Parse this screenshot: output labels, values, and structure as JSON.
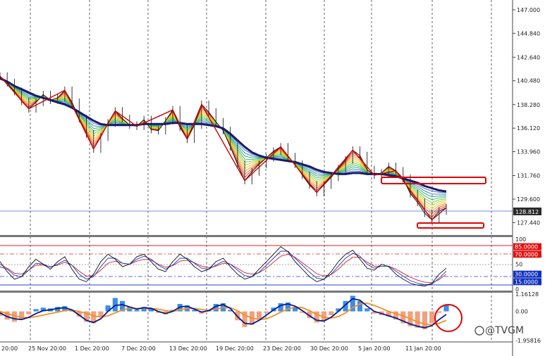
{
  "chart_data": {
    "type": "line",
    "instrument_panel": {
      "price_label": "128.812",
      "y_ticks": [
        "147.000",
        "144.840",
        "142.640",
        "140.480",
        "138.280",
        "136.120",
        "133.960",
        "131.760",
        "129.600",
        "127.440"
      ],
      "y_tick_values": [
        147.0,
        144.84,
        142.64,
        140.48,
        138.28,
        136.12,
        133.96,
        131.76,
        129.6,
        127.44
      ],
      "ylim": [
        126.3,
        147.9
      ],
      "current_price": 128.812
    },
    "x_tick_labels": [
      "20:00",
      "25 Nov 20:00",
      "1 Dec 20:00",
      "7 Dec 20:00",
      "13 Dec 20:00",
      "19 Dec 20:00",
      "23 Dec 20:00",
      "30 Dec 20:00",
      "5 Jan 20:00",
      "11 Jan 20:00"
    ],
    "price_series": [
      140.9,
      140.3,
      139.5,
      138.6,
      137.9,
      138.5,
      139.2,
      138.7,
      138.9,
      139.6,
      138.5,
      137.0,
      135.6,
      134.2,
      135.3,
      136.6,
      137.7,
      137.0,
      136.4,
      136.3,
      136.9,
      136.0,
      135.9,
      136.8,
      137.8,
      136.2,
      135.1,
      136.4,
      138.3,
      137.6,
      136.7,
      135.9,
      134.4,
      132.8,
      131.3,
      132.1,
      132.8,
      133.4,
      134.0,
      134.4,
      133.5,
      132.8,
      131.8,
      130.9,
      130.2,
      130.9,
      131.6,
      132.4,
      133.2,
      134.1,
      133.6,
      132.3,
      131.8,
      132.0,
      132.6,
      132.2,
      131.5,
      130.1,
      129.3,
      128.3,
      127.7,
      128.5,
      128.8
    ],
    "ma_series": [
      140.7,
      140.4,
      140.0,
      139.7,
      139.4,
      139.1,
      138.9,
      138.7,
      138.5,
      138.3,
      138.0,
      137.6,
      137.2,
      136.8,
      136.5,
      136.4,
      136.4,
      136.4,
      136.4,
      136.4,
      136.5,
      136.5,
      136.5,
      136.5,
      136.6,
      136.6,
      136.5,
      136.5,
      136.5,
      136.4,
      136.3,
      136.1,
      135.6,
      135.0,
      134.4,
      133.9,
      133.6,
      133.4,
      133.3,
      133.2,
      133.1,
      133.0,
      132.8,
      132.6,
      132.3,
      132.1,
      132.0,
      131.9,
      131.9,
      132.0,
      132.0,
      131.9,
      131.9,
      131.9,
      131.8,
      131.7,
      131.5,
      131.3,
      131.1,
      130.8,
      130.6,
      130.4,
      130.3
    ],
    "stoch_panel": {
      "y_ticks": [
        "100",
        "85.0000",
        "70.0000",
        "50",
        "30.0000",
        "15.0000",
        "0"
      ],
      "levels": [
        85,
        70,
        50,
        30,
        15
      ],
      "ylim": [
        0,
        100
      ],
      "series_a": [
        55,
        35,
        20,
        25,
        45,
        60,
        50,
        40,
        55,
        65,
        40,
        20,
        15,
        30,
        55,
        70,
        60,
        45,
        50,
        65,
        70,
        55,
        40,
        35,
        55,
        70,
        60,
        45,
        35,
        40,
        55,
        62,
        45,
        30,
        20,
        25,
        40,
        55,
        70,
        85,
        75,
        55,
        40,
        25,
        15,
        20,
        35,
        55,
        70,
        78,
        60,
        42,
        38,
        50,
        45,
        30,
        20,
        12,
        8,
        6,
        12,
        30,
        42
      ],
      "series_b": [
        45,
        40,
        28,
        25,
        38,
        52,
        50,
        44,
        50,
        58,
        48,
        30,
        20,
        25,
        45,
        62,
        62,
        52,
        50,
        60,
        66,
        60,
        48,
        40,
        48,
        62,
        62,
        52,
        42,
        40,
        48,
        56,
        50,
        38,
        27,
        25,
        34,
        48,
        62,
        76,
        76,
        62,
        48,
        34,
        22,
        20,
        30,
        46,
        62,
        72,
        66,
        50,
        42,
        46,
        46,
        36,
        26,
        17,
        12,
        9,
        10,
        22,
        36
      ],
      "series_c": [
        50,
        42,
        32,
        30,
        38,
        48,
        48,
        45,
        48,
        54,
        48,
        36,
        26,
        27,
        38,
        52,
        56,
        52,
        50,
        56,
        60,
        58,
        50,
        44,
        47,
        56,
        58,
        53,
        46,
        43,
        46,
        52,
        50,
        42,
        33,
        30,
        33,
        42,
        54,
        66,
        70,
        64,
        53,
        42,
        31,
        26,
        29,
        40,
        54,
        64,
        64,
        54,
        46,
        46,
        46,
        40,
        32,
        24,
        18,
        14,
        13,
        19,
        30
      ]
    },
    "macd_panel": {
      "y_ticks": [
        "1.16128",
        "0.00",
        "-1.95816"
      ],
      "ylim": [
        -1.95816,
        1.16128
      ],
      "histogram": [
        -0.3,
        -0.55,
        -0.7,
        -0.55,
        -0.2,
        0.15,
        0.25,
        0.2,
        0.3,
        0.35,
        0.1,
        -0.35,
        -0.7,
        -0.8,
        -0.35,
        0.4,
        0.9,
        0.7,
        0.3,
        0.1,
        0.3,
        0.2,
        -0.1,
        -0.2,
        0.1,
        0.5,
        0.4,
        0.1,
        -0.15,
        0.1,
        0.5,
        0.55,
        0.1,
        -0.6,
        -1.05,
        -0.9,
        -0.5,
        -0.1,
        0.25,
        0.55,
        0.6,
        0.3,
        -0.1,
        -0.45,
        -0.75,
        -0.65,
        -0.25,
        0.2,
        0.7,
        1.05,
        0.7,
        0.2,
        -0.15,
        -0.25,
        -0.35,
        -0.55,
        -0.8,
        -1.0,
        -1.1,
        -1.2,
        -0.8,
        -0.1,
        0.4
      ],
      "line_fast": [
        -0.1,
        -0.35,
        -0.5,
        -0.55,
        -0.4,
        -0.15,
        0.05,
        0.1,
        0.2,
        0.25,
        0.1,
        -0.25,
        -0.6,
        -0.75,
        -0.5,
        0.0,
        0.4,
        0.45,
        0.3,
        0.15,
        0.25,
        0.2,
        0.0,
        -0.15,
        0.0,
        0.3,
        0.35,
        0.15,
        -0.05,
        0.05,
        0.35,
        0.45,
        0.2,
        -0.35,
        -0.8,
        -0.85,
        -0.6,
        -0.25,
        0.1,
        0.4,
        0.5,
        0.35,
        0.05,
        -0.3,
        -0.6,
        -0.65,
        -0.4,
        0.0,
        0.45,
        0.85,
        0.75,
        0.35,
        0.0,
        -0.15,
        -0.3,
        -0.45,
        -0.65,
        -0.85,
        -1.0,
        -1.1,
        -0.95,
        -0.55,
        -0.2
      ],
      "line_slow": [
        0.0,
        -0.15,
        -0.3,
        -0.4,
        -0.42,
        -0.35,
        -0.25,
        -0.15,
        -0.05,
        0.05,
        0.08,
        0.0,
        -0.15,
        -0.3,
        -0.38,
        -0.3,
        -0.1,
        0.1,
        0.2,
        0.2,
        0.2,
        0.2,
        0.15,
        0.05,
        0.0,
        0.1,
        0.2,
        0.2,
        0.12,
        0.08,
        0.15,
        0.25,
        0.25,
        0.05,
        -0.25,
        -0.45,
        -0.55,
        -0.5,
        -0.3,
        -0.05,
        0.15,
        0.3,
        0.25,
        0.05,
        -0.2,
        -0.4,
        -0.45,
        -0.35,
        -0.1,
        0.25,
        0.5,
        0.55,
        0.4,
        0.2,
        0.0,
        -0.15,
        -0.3,
        -0.5,
        -0.7,
        -0.85,
        -0.9,
        -0.8,
        -0.6
      ]
    },
    "annotations": {
      "watermark": "@TVGM"
    },
    "colors": {
      "price_line": "#111111",
      "ma_line": "#1a1a66",
      "zigzag": "#cc0000",
      "highlight_box": "#e00000",
      "price_label_bg": "#2a2a2a",
      "level_85_bg": "#e01010",
      "level_30_bg": "#1030c0",
      "hist_pos": "#3a8ee8",
      "hist_neg": "#f0a080",
      "macd_fast": "#0a1a8a",
      "macd_slow": "#f39020",
      "stoch_a": "#111111",
      "stoch_b": "#1a3acc",
      "stoch_c": "#cc2222"
    }
  }
}
